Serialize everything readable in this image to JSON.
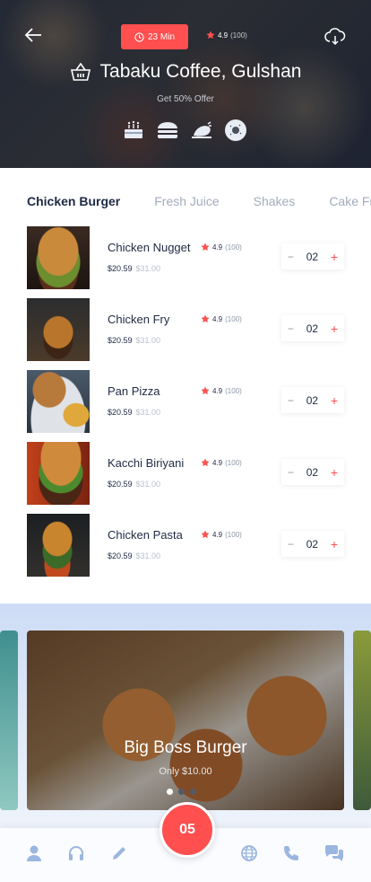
{
  "header": {
    "time": "23 Min",
    "rating": "4.9",
    "rating_count": "(100)",
    "restaurant": "Tabaku Coffee, Gulshan",
    "offer": "Get 50% Offer",
    "categories": [
      "cake-icon",
      "burger-icon",
      "chicken-leg-icon",
      "donut-icon"
    ]
  },
  "tabs": [
    "Chicken Burger",
    "Fresh Juice",
    "Shakes",
    "Cake Fries"
  ],
  "items": [
    {
      "name": "Chicken Nugget",
      "rating": "4.9",
      "count": "(100)",
      "price": "$20.59",
      "old_price": "$31.00",
      "qty": "02"
    },
    {
      "name": "Chicken Fry",
      "rating": "4.9",
      "count": "(100)",
      "price": "$20.59",
      "old_price": "$31.00",
      "qty": "02"
    },
    {
      "name": "Pan Pizza",
      "rating": "4.9",
      "count": "(100)",
      "price": "$20.59",
      "old_price": "$31.00",
      "qty": "02"
    },
    {
      "name": "Kacchi Biriyani",
      "rating": "4.9",
      "count": "(100)",
      "price": "$20.59",
      "old_price": "$31.00",
      "qty": "02"
    },
    {
      "name": "Chicken Pasta",
      "rating": "4.9",
      "count": "(100)",
      "price": "$20.59",
      "old_price": "$31.00",
      "qty": "02"
    }
  ],
  "promo": {
    "title": "Big Boss Burger",
    "subtitle": "Only $10.00"
  },
  "cart": {
    "count": "05"
  },
  "colors": {
    "accent": "#ff4f4f",
    "text": "#1e2a44",
    "muted": "#a3acbc",
    "icon_blue": "#9bb6e0"
  }
}
